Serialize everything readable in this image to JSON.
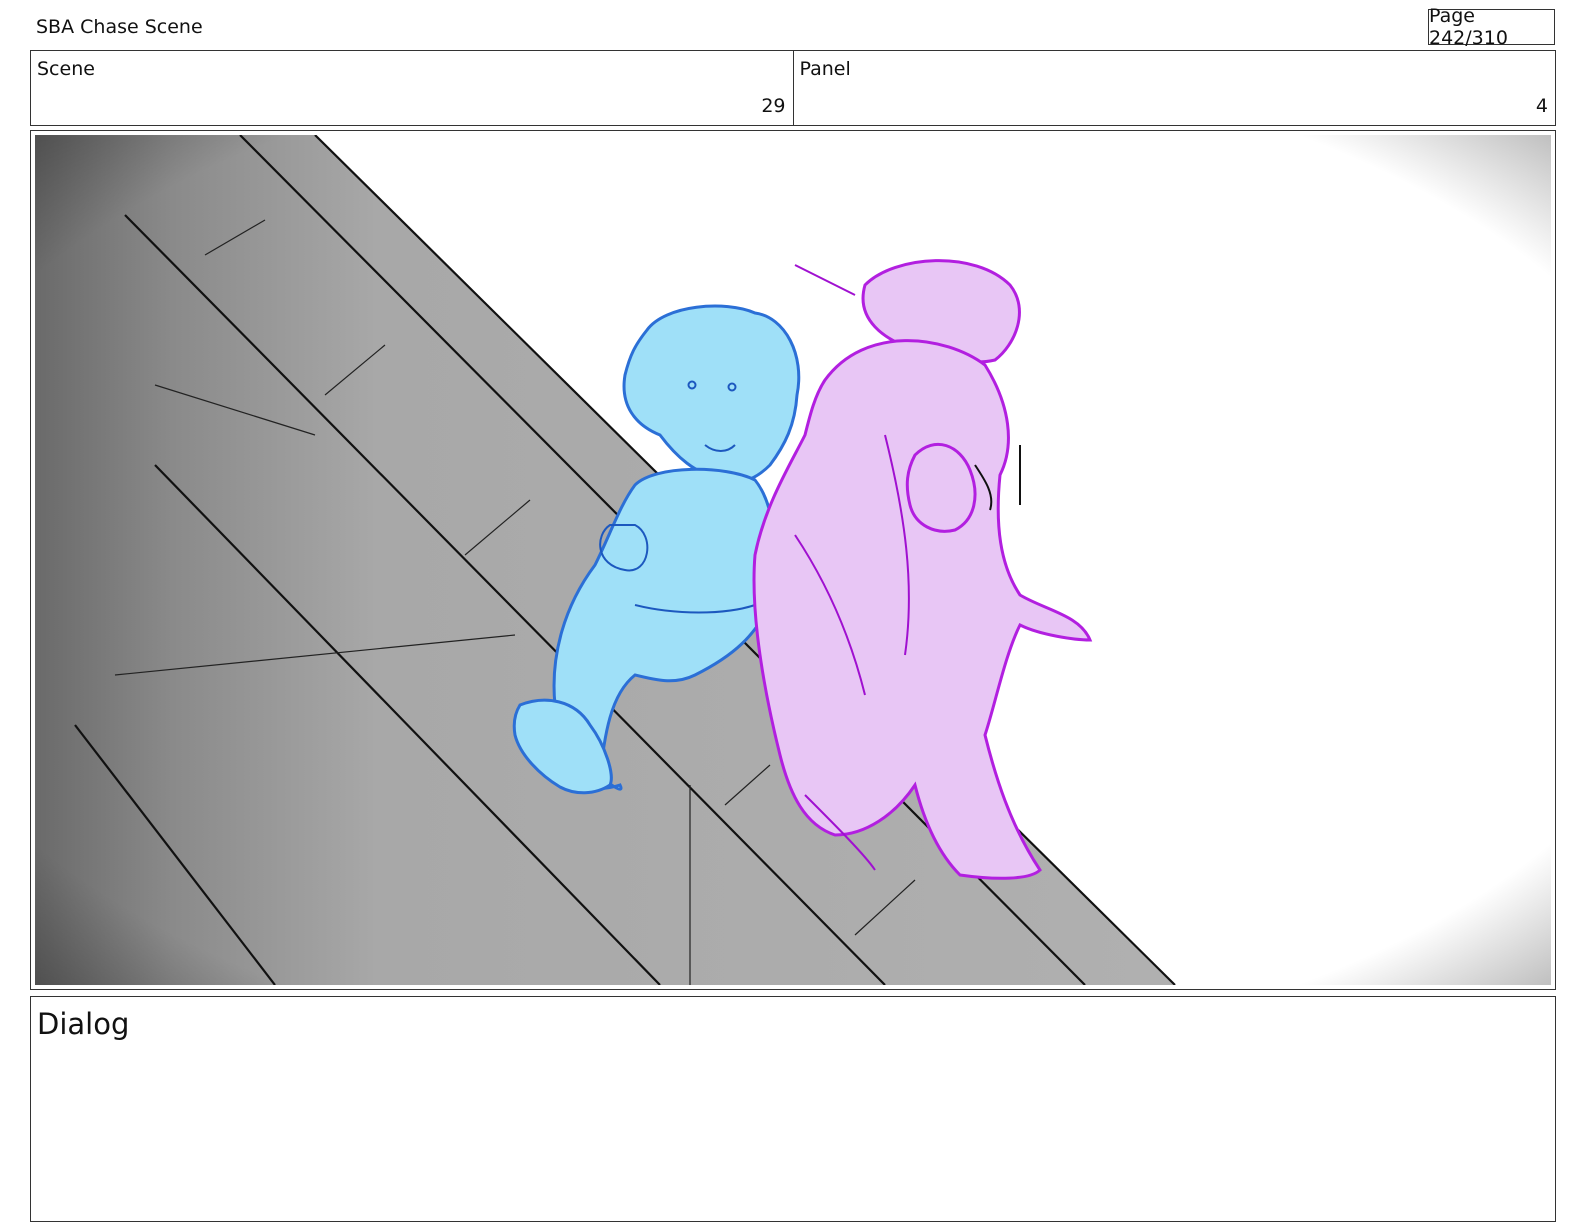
{
  "header": {
    "title": "SBA Chase Scene",
    "page_label": "Page 242/310"
  },
  "info": {
    "scene_label": "Scene",
    "scene_value": "29",
    "panel_label": "Panel",
    "panel_value": "4"
  },
  "dialog": {
    "label": "Dialog"
  },
  "colors": {
    "blue_character": "#9fe0f8",
    "blue_line": "#2b6fd6",
    "pink_character": "#e8c6f5",
    "pink_line": "#b21fe0",
    "stone_gray": "#a9a9a9"
  }
}
